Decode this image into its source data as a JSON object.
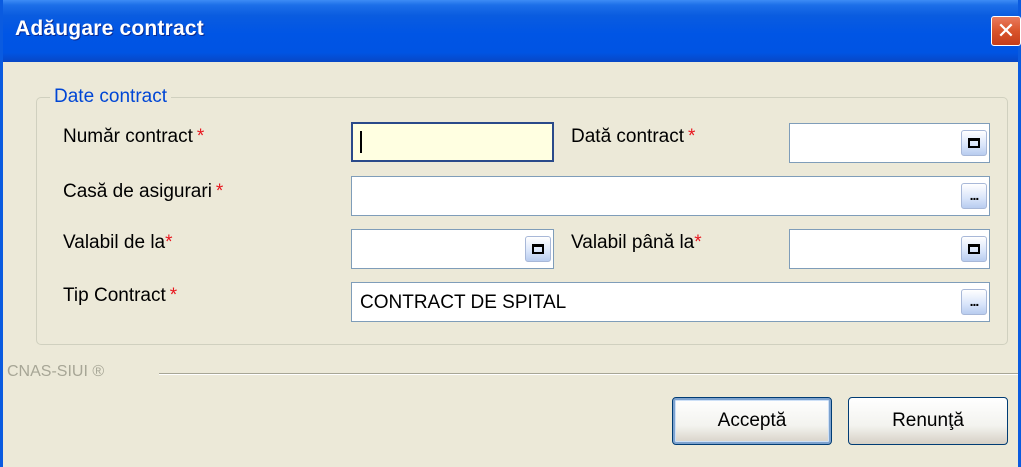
{
  "window": {
    "title": "Adăugare contract",
    "close_glyph": "✕"
  },
  "group": {
    "legend": "Date contract"
  },
  "fields": {
    "numar_contract": {
      "label": "Număr contract",
      "required": "*",
      "value": ""
    },
    "data_contract": {
      "label": "Dată contract",
      "required": "*",
      "value": ""
    },
    "casa_asigurari": {
      "label": "Casă de asigurari",
      "required": "*",
      "value": ""
    },
    "valabil_de_la": {
      "label": "Valabil de la",
      "required": "*",
      "value": ""
    },
    "valabil_pana_la": {
      "label": "Valabil până la",
      "required": "*",
      "value": ""
    },
    "tip_contract": {
      "label": "Tip Contract",
      "required": "*",
      "value": "CONTRACT DE SPITAL"
    }
  },
  "icons": {
    "calendar": "calendar-icon",
    "browse": "ellipsis-icon",
    "browse_glyph": "..."
  },
  "footer": {
    "brand": "CNAS-SIUI ®",
    "accept_label": "Acceptă",
    "cancel_label": "Renunţă"
  },
  "colors": {
    "titlebar": "#0054e3",
    "legend": "#0046d5",
    "required": "#e8161e",
    "focused_field": "#ffffe1"
  }
}
